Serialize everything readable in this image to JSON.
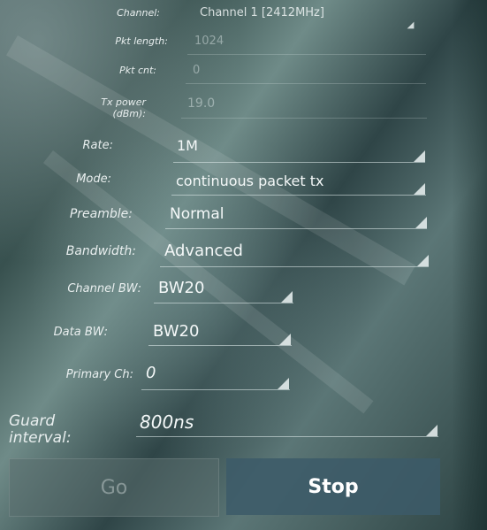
{
  "form": {
    "channel": {
      "label": "Channel:",
      "value": "Channel 1 [2412MHz]"
    },
    "pkt_length": {
      "label": "Pkt length:",
      "placeholder": "1024"
    },
    "pkt_cnt": {
      "label": "Pkt cnt:",
      "placeholder": "0"
    },
    "tx_power": {
      "label_line1": "Tx power",
      "label_line2": "(dBm):",
      "placeholder": "19.0"
    },
    "rate": {
      "label": "Rate:",
      "value": "1M"
    },
    "mode": {
      "label": "Mode:",
      "value": "continuous packet tx"
    },
    "preamble": {
      "label": "Preamble:",
      "value": "Normal"
    },
    "bandwidth": {
      "label": "Bandwidth:",
      "value": "Advanced"
    },
    "channel_bw": {
      "label": "Channel BW:",
      "value": "BW20"
    },
    "data_bw": {
      "label": "Data BW:",
      "value": "BW20"
    },
    "primary_ch": {
      "label": "Primary Ch:",
      "value": "0"
    },
    "guard_interval": {
      "label_line1": "Guard",
      "label_line2": "interval:",
      "value": "800ns"
    }
  },
  "buttons": {
    "go_label": "Go",
    "stop_label": "Stop"
  },
  "colors": {
    "stop_button": "#3c5a69",
    "text": "#f4f8f8"
  }
}
